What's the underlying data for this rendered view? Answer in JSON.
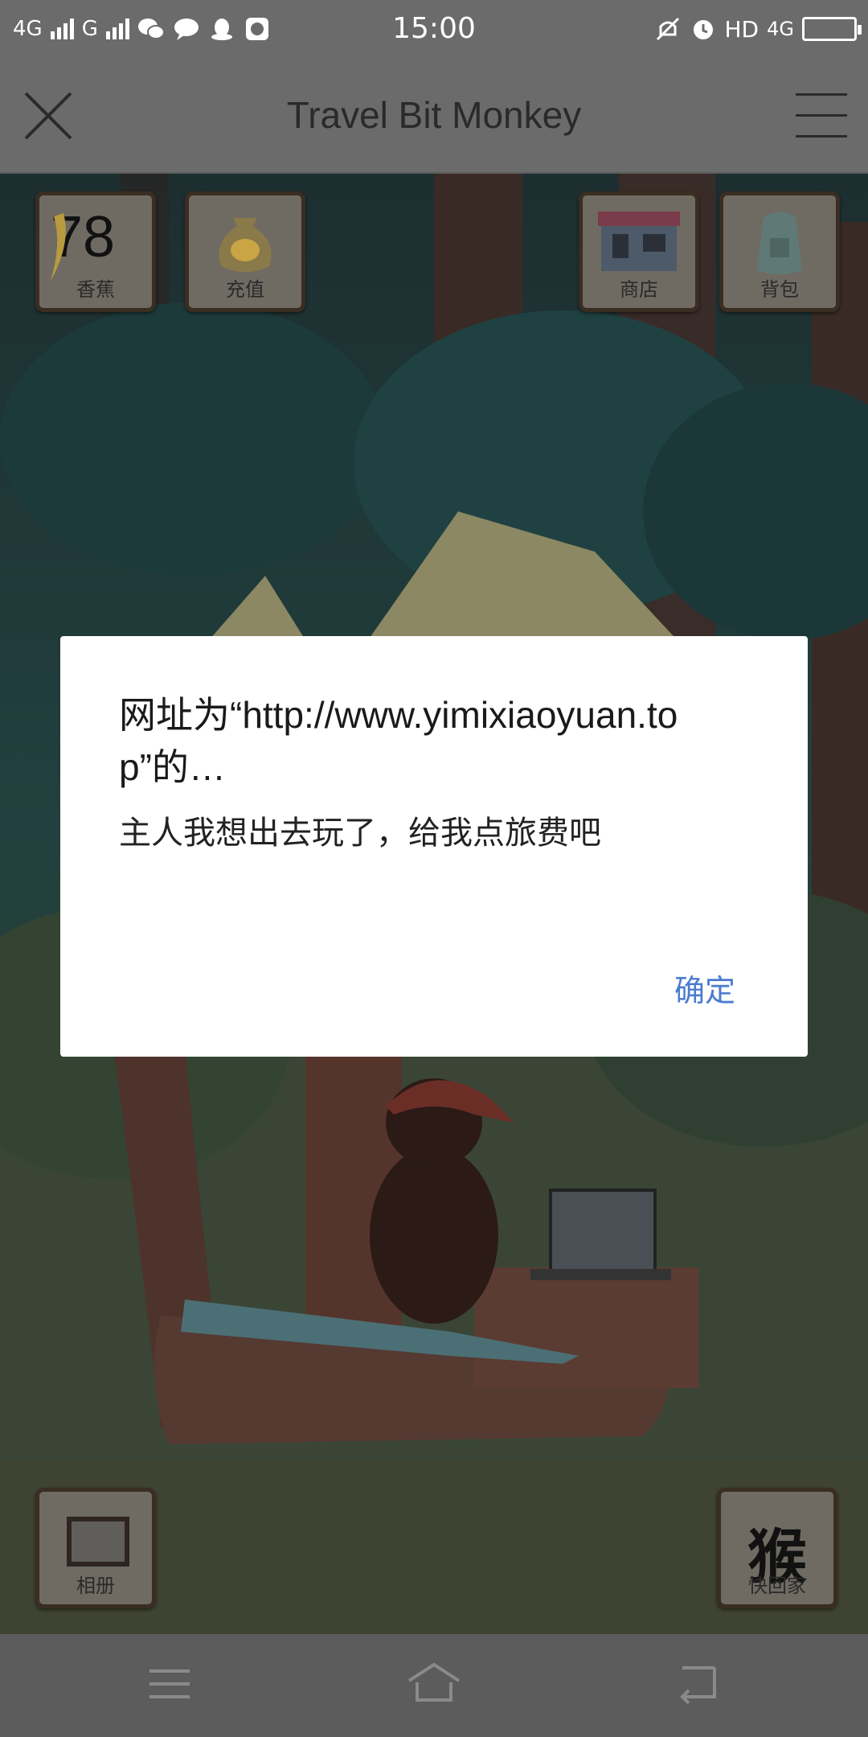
{
  "status_bar": {
    "network_1": "4G",
    "network_2": "G",
    "time": "15:00",
    "hd_label": "HD",
    "network_3": "4G"
  },
  "title_bar": {
    "title": "Travel Bit Monkey"
  },
  "hud": {
    "banana_count": "78",
    "banana_label": "香蕉",
    "recharge_label": "充值",
    "shop_label": "商店",
    "backpack_label": "背包",
    "album_label": "相册",
    "home_big_char": "猴",
    "home_label": "快回家"
  },
  "dialog": {
    "title": "网址为“http://www.yimixiaoyuan.top”的…",
    "message": "主人我想出去玩了，给我点旅费吧",
    "ok_label": "确定",
    "ok_color": "#4a7bd0"
  }
}
